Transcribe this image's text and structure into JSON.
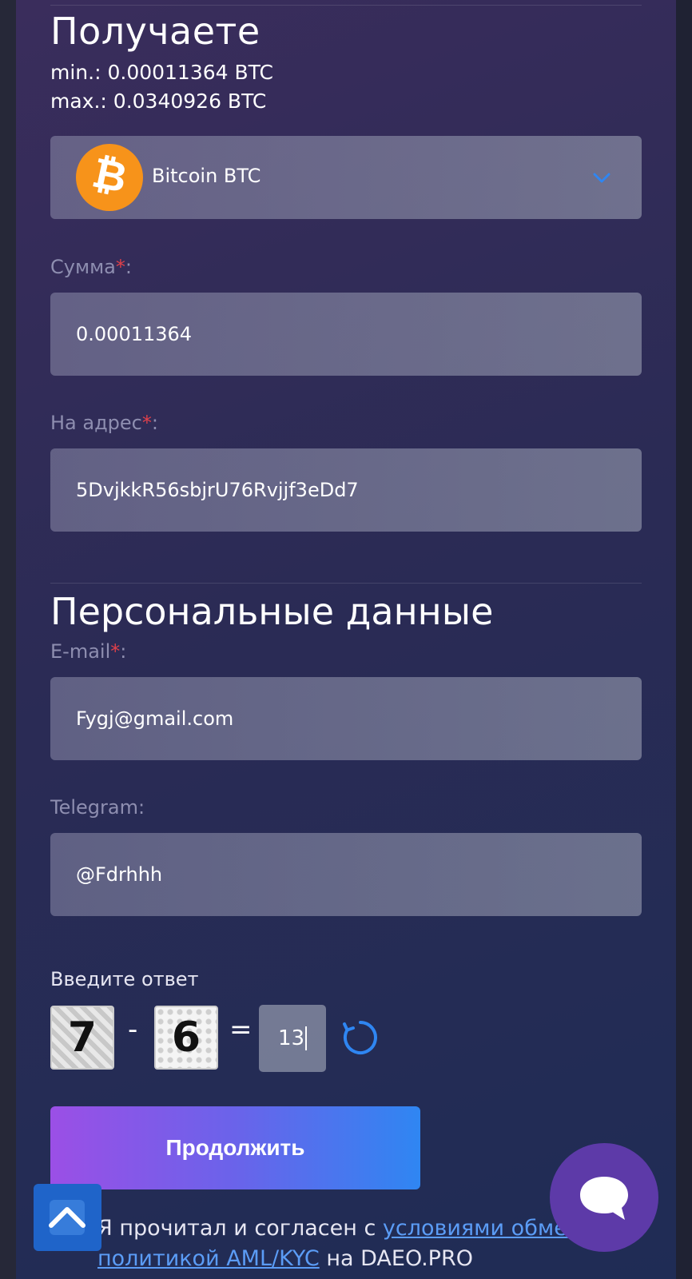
{
  "receive": {
    "heading": "Получаете",
    "min_text": "min.: 0.00011364 BTC",
    "max_text": "max.: 0.0340926 BTC",
    "coin": {
      "name": "Bitcoin BTC",
      "icon": "bitcoin-icon",
      "brand_color": "#f7931a"
    }
  },
  "amount": {
    "label": "Сумма",
    "required_mark": "*",
    "suffix": ":",
    "value": "0.00011364"
  },
  "address": {
    "label": "На адрес",
    "required_mark": "*",
    "suffix": ":",
    "value": "5DvjkkR56sbjrU76Rvjjf3eDd7"
  },
  "personal": {
    "heading": "Персональные данные",
    "email": {
      "label": "E-mail",
      "required_mark": "*",
      "suffix": ":",
      "value": "Fygj@gmail.com"
    },
    "telegram": {
      "label": "Telegram:",
      "value": "@Fdrhhh"
    }
  },
  "captcha": {
    "label": "Введите ответ",
    "operand_a": "7",
    "operator": "-",
    "operand_b": "6",
    "equals": "=",
    "answer": "13"
  },
  "submit_label": "Продолжить",
  "agreement": {
    "prefix": "Я прочитал и согласен с ",
    "terms_link": "условиями обмена",
    "middle": " ",
    "aml_link": "политикой AML/KYC",
    "suffix": " на DAEO.PRO"
  },
  "colors": {
    "accent_blue": "#2f86f2",
    "accent_purple": "#9b4fe6",
    "required_red": "#e0404a",
    "chat_button": "#5d3aa8",
    "scroll_top_button": "#1f64c9"
  }
}
